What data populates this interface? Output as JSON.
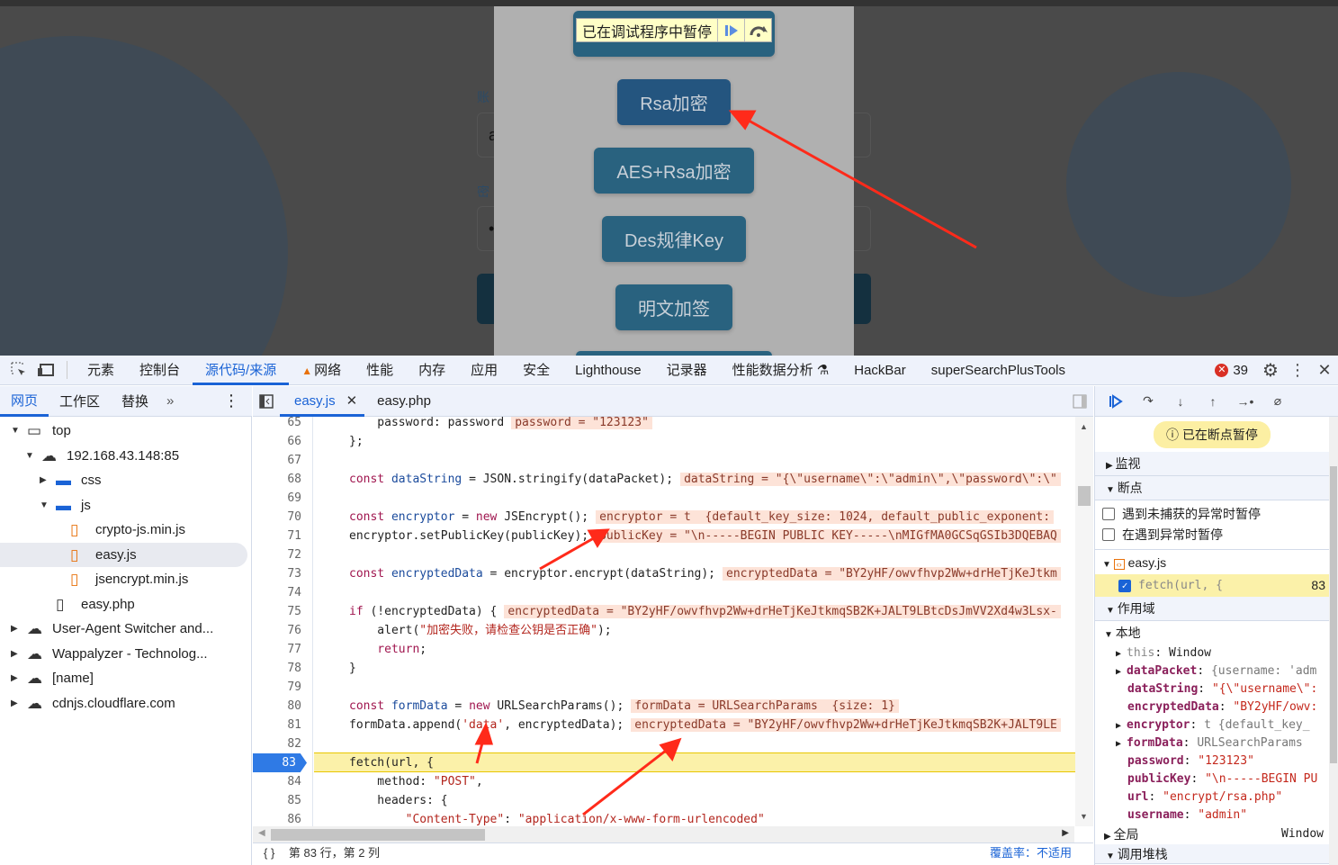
{
  "page": {
    "paused_label": "已在调试程序中暂停",
    "bg_label_account": "账",
    "bg_label_password": "密",
    "bg_input_value": "a",
    "bg_password_value": "•",
    "buttons": [
      "Rsa加密",
      "AES+Rsa加密",
      "Des规律Key",
      "明文加签"
    ]
  },
  "devtools": {
    "tabs": [
      "元素",
      "控制台",
      "源代码/来源",
      "网络",
      "性能",
      "内存",
      "应用",
      "安全",
      "Lighthouse",
      "记录器",
      "性能数据分析",
      "HackBar",
      "superSearchPlusTools"
    ],
    "active_tab": "源代码/来源",
    "error_count": "39",
    "nav_tabs": [
      "网页",
      "工作区",
      "替换"
    ],
    "file_tabs": [
      "easy.js",
      "easy.php"
    ],
    "tree": [
      {
        "label": "top",
        "depth": 0,
        "icon": "frame",
        "open": true
      },
      {
        "label": "192.168.43.148:85",
        "depth": 1,
        "icon": "cloud",
        "open": true
      },
      {
        "label": "css",
        "depth": 2,
        "icon": "folder",
        "open": false
      },
      {
        "label": "js",
        "depth": 2,
        "icon": "folder",
        "open": true
      },
      {
        "label": "crypto-js.min.js",
        "depth": 3,
        "icon": "file-js"
      },
      {
        "label": "easy.js",
        "depth": 3,
        "icon": "file-js",
        "selected": true
      },
      {
        "label": "jsencrypt.min.js",
        "depth": 3,
        "icon": "file-js"
      },
      {
        "label": "easy.php",
        "depth": 2,
        "icon": "file"
      },
      {
        "label": "User-Agent Switcher and...",
        "depth": 0,
        "icon": "cloud",
        "open": false
      },
      {
        "label": "Wappalyzer - Technolog...",
        "depth": 0,
        "icon": "cloud",
        "open": false
      },
      {
        "label": "[name]",
        "depth": 0,
        "icon": "cloud",
        "open": false
      },
      {
        "label": "cdnjs.cloudflare.com",
        "depth": 0,
        "icon": "cloud",
        "open": false
      }
    ],
    "code": [
      {
        "n": "65",
        "t": [
          [
            "p",
            "    password: password"
          ]
        ],
        "i": "password = \"123123\""
      },
      {
        "n": "66",
        "t": [
          [
            "p",
            "};"
          ]
        ]
      },
      {
        "n": "67",
        "t": []
      },
      {
        "n": "68",
        "t": [
          [
            "k",
            "const "
          ],
          [
            "v",
            "dataString"
          ],
          [
            "p",
            " = JSON.stringify(dataPacket);"
          ]
        ],
        "i": "dataString = \"{\\\"username\\\":\\\"admin\\\",\\\"password\\\":\\\""
      },
      {
        "n": "69",
        "t": []
      },
      {
        "n": "70",
        "t": [
          [
            "k",
            "const "
          ],
          [
            "v",
            "encryptor"
          ],
          [
            "p",
            " = "
          ],
          [
            "k",
            "new"
          ],
          [
            "p",
            " JSEncrypt();"
          ]
        ],
        "i": "encryptor = t  {default_key_size: 1024, default_public_exponent:"
      },
      {
        "n": "71",
        "t": [
          [
            "p",
            "encryptor.setPublicKey(publicKey);"
          ]
        ],
        "i": "publicKey = \"\\n-----BEGIN PUBLIC KEY-----\\nMIGfMA0GCSqGSIb3DQEBAQ"
      },
      {
        "n": "72",
        "t": []
      },
      {
        "n": "73",
        "t": [
          [
            "k",
            "const "
          ],
          [
            "v",
            "encryptedData"
          ],
          [
            "p",
            " = encryptor.encrypt(dataString);"
          ]
        ],
        "i": "encryptedData = \"BY2yHF/owvfhvp2Ww+drHeTjKeJtkm"
      },
      {
        "n": "74",
        "t": []
      },
      {
        "n": "75",
        "t": [
          [
            "k",
            "if"
          ],
          [
            "p",
            " (!encryptedData) {"
          ]
        ],
        "i": "encryptedData = \"BY2yHF/owvfhvp2Ww+drHeTjKeJtkmqSB2K+JALT9LBtcDsJmVV2Xd4w3Lsx-"
      },
      {
        "n": "76",
        "t": [
          [
            "p",
            "    alert("
          ],
          [
            "s",
            "\"加密失败，请检查公钥是否正确\""
          ],
          [
            "p",
            ");"
          ]
        ]
      },
      {
        "n": "77",
        "t": [
          [
            "k",
            "    return"
          ],
          [
            "p",
            ";"
          ]
        ]
      },
      {
        "n": "78",
        "t": [
          [
            "p",
            "}"
          ]
        ]
      },
      {
        "n": "79",
        "t": []
      },
      {
        "n": "80",
        "t": [
          [
            "k",
            "const "
          ],
          [
            "v",
            "formData"
          ],
          [
            "p",
            " = "
          ],
          [
            "k",
            "new"
          ],
          [
            "p",
            " URLSearchParams();"
          ]
        ],
        "i": "formData = URLSearchParams  {size: 1}"
      },
      {
        "n": "81",
        "t": [
          [
            "p",
            "formData.append("
          ],
          [
            "s",
            "'data'"
          ],
          [
            "p",
            ", encryptedData);"
          ]
        ],
        "i": "encryptedData = \"BY2yHF/owvfhvp2Ww+drHeTjKeJtkmqSB2K+JALT9LE"
      },
      {
        "n": "82",
        "t": []
      },
      {
        "n": "83",
        "t": [
          [
            "p",
            "fetch(url, {"
          ]
        ],
        "bp": true
      },
      {
        "n": "84",
        "t": [
          [
            "p",
            "    method: "
          ],
          [
            "s",
            "\"POST\""
          ],
          [
            "p",
            ","
          ]
        ]
      },
      {
        "n": "85",
        "t": [
          [
            "p",
            "    headers: {"
          ]
        ]
      },
      {
        "n": "86",
        "t": [
          [
            "s",
            "        \"Content-Type\""
          ],
          [
            "p",
            ": "
          ],
          [
            "s",
            "\"application/x-www-form-urlencoded\""
          ]
        ]
      }
    ],
    "status": {
      "position": "第 83 行，第 2 列",
      "coverage": "覆盖率：不适用"
    },
    "right": {
      "paused_badge": "已在断点暂停",
      "watch": "监视",
      "breakpoints": "断点",
      "pause_uncaught": "遇到未捕获的异常时暂停",
      "pause_caught": "在遇到异常时暂停",
      "bp_file": "easy.js",
      "bp_code": "fetch(url, {",
      "bp_line": "83",
      "scope": "作用域",
      "local": "本地",
      "global": "全局",
      "global_value": "Window",
      "callstack": "调用堆栈",
      "vars": [
        {
          "k": "this",
          "v": "Window",
          "exp": true,
          "dim": true
        },
        {
          "k": "dataPacket",
          "v": "{username: 'adm",
          "exp": true,
          "type": "obj"
        },
        {
          "k": "dataString",
          "v": "\"{\\\"username\\\":",
          "type": "str"
        },
        {
          "k": "encryptedData",
          "v": "\"BY2yHF/owv:",
          "type": "str"
        },
        {
          "k": "encryptor",
          "v": "t  {default_key_",
          "exp": true,
          "type": "obj"
        },
        {
          "k": "formData",
          "v": "URLSearchParams",
          "exp": true,
          "type": "obj"
        },
        {
          "k": "password",
          "v": "\"123123\"",
          "type": "str"
        },
        {
          "k": "publicKey",
          "v": "\"\\n-----BEGIN PU",
          "type": "str"
        },
        {
          "k": "url",
          "v": "\"encrypt/rsa.php\"",
          "type": "str"
        },
        {
          "k": "username",
          "v": "\"admin\"",
          "type": "str"
        }
      ]
    },
    "colors": {
      "accent": "#1a63d6",
      "breakpoint": "#2f7ae5",
      "paused_line": "#fbf1a9",
      "annotation_arrow": "#ff2a1a"
    }
  }
}
